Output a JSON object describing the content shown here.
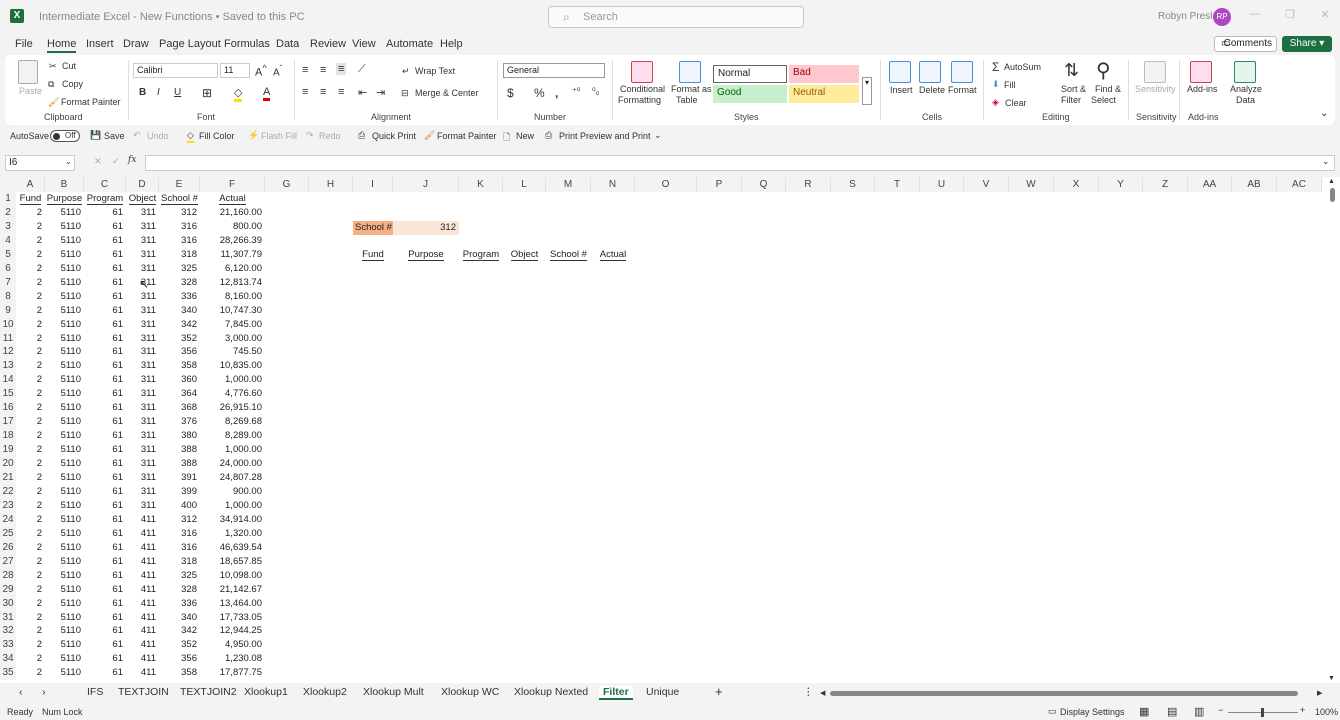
{
  "window": {
    "title": "Intermediate Excel - New Functions • Saved to this PC",
    "search_placeholder": "Search",
    "user": "Robyn Presley",
    "user_initials": "RP"
  },
  "menu": [
    "File",
    "Home",
    "Insert",
    "Draw",
    "Page Layout",
    "Formulas",
    "Data",
    "Review",
    "View",
    "Automate",
    "Help"
  ],
  "menu_active": "Home",
  "buttons": {
    "comments": "Comments",
    "share": "Share"
  },
  "ribbon": {
    "clipboard": {
      "paste": "Paste",
      "cut": "Cut",
      "copy": "Copy",
      "format_painter": "Format Painter",
      "label": "Clipboard"
    },
    "font": {
      "name": "Calibri",
      "size": "11",
      "label": "Font"
    },
    "alignment": {
      "wrap": "Wrap Text",
      "merge": "Merge & Center",
      "label": "Alignment"
    },
    "number": {
      "format": "General",
      "label": "Number"
    },
    "styles": {
      "cond": "Conditional",
      "cond2": "Formatting",
      "table": "Format as",
      "table2": "Table",
      "normal": "Normal",
      "bad": "Bad",
      "good": "Good",
      "neutral": "Neutral",
      "label": "Styles"
    },
    "cells": {
      "insert": "Insert",
      "delete": "Delete",
      "format": "Format",
      "label": "Cells"
    },
    "editing": {
      "autosum": "AutoSum",
      "fill": "Fill",
      "clear": "Clear",
      "sort": "Sort &",
      "sort2": "Filter",
      "find": "Find &",
      "find2": "Select",
      "label": "Editing"
    },
    "sensitivity": {
      "btn": "Sensitivity",
      "label": "Sensitivity"
    },
    "addins": {
      "btn": "Add-ins",
      "label": "Add-ins"
    },
    "analyze": {
      "btn": "Analyze",
      "btn2": "Data"
    }
  },
  "qat": {
    "autosave": "AutoSave",
    "off": "Off",
    "save": "Save",
    "undo": "Undo",
    "fill_color": "Fill Color",
    "flash_fill": "Flash Fill",
    "redo": "Redo",
    "quick_print": "Quick Print",
    "format_painter": "Format Painter",
    "new": "New",
    "print_preview": "Print Preview and Print"
  },
  "name_box": "I6",
  "columns": [
    "A",
    "B",
    "C",
    "D",
    "E",
    "F",
    "G",
    "H",
    "I",
    "J",
    "K",
    "L",
    "M",
    "N",
    "O",
    "P",
    "Q",
    "R",
    "S",
    "T",
    "U",
    "V",
    "W",
    "X",
    "Y",
    "Z",
    "AA",
    "AB",
    "AC"
  ],
  "headers": [
    "Fund",
    "Purpose",
    "Program",
    "Object",
    "School #",
    "Actual"
  ],
  "rows": [
    [
      "2",
      "5110",
      "61",
      "311",
      "312",
      "21,160.00"
    ],
    [
      "2",
      "5110",
      "61",
      "311",
      "316",
      "800.00"
    ],
    [
      "2",
      "5110",
      "61",
      "311",
      "316",
      "28,266.39"
    ],
    [
      "2",
      "5110",
      "61",
      "311",
      "318",
      "11,307.79"
    ],
    [
      "2",
      "5110",
      "61",
      "311",
      "325",
      "6,120.00"
    ],
    [
      "2",
      "5110",
      "61",
      "311",
      "328",
      "12,813.74"
    ],
    [
      "2",
      "5110",
      "61",
      "311",
      "336",
      "8,160.00"
    ],
    [
      "2",
      "5110",
      "61",
      "311",
      "340",
      "10,747.30"
    ],
    [
      "2",
      "5110",
      "61",
      "311",
      "342",
      "7,845.00"
    ],
    [
      "2",
      "5110",
      "61",
      "311",
      "352",
      "3,000.00"
    ],
    [
      "2",
      "5110",
      "61",
      "311",
      "356",
      "745.50"
    ],
    [
      "2",
      "5110",
      "61",
      "311",
      "358",
      "10,835.00"
    ],
    [
      "2",
      "5110",
      "61",
      "311",
      "360",
      "1,000.00"
    ],
    [
      "2",
      "5110",
      "61",
      "311",
      "364",
      "4,776.60"
    ],
    [
      "2",
      "5110",
      "61",
      "311",
      "368",
      "26,915.10"
    ],
    [
      "2",
      "5110",
      "61",
      "311",
      "376",
      "8,269.68"
    ],
    [
      "2",
      "5110",
      "61",
      "311",
      "380",
      "8,289.00"
    ],
    [
      "2",
      "5110",
      "61",
      "311",
      "388",
      "1,000.00"
    ],
    [
      "2",
      "5110",
      "61",
      "311",
      "388",
      "24,000.00"
    ],
    [
      "2",
      "5110",
      "61",
      "311",
      "391",
      "24,807.28"
    ],
    [
      "2",
      "5110",
      "61",
      "311",
      "399",
      "900.00"
    ],
    [
      "2",
      "5110",
      "61",
      "311",
      "400",
      "1,000.00"
    ],
    [
      "2",
      "5110",
      "61",
      "411",
      "312",
      "34,914.00"
    ],
    [
      "2",
      "5110",
      "61",
      "411",
      "316",
      "1,320.00"
    ],
    [
      "2",
      "5110",
      "61",
      "411",
      "316",
      "46,639.54"
    ],
    [
      "2",
      "5110",
      "61",
      "411",
      "318",
      "18,657.85"
    ],
    [
      "2",
      "5110",
      "61",
      "411",
      "325",
      "10,098.00"
    ],
    [
      "2",
      "5110",
      "61",
      "411",
      "328",
      "21,142.67"
    ],
    [
      "2",
      "5110",
      "61",
      "411",
      "336",
      "13,464.00"
    ],
    [
      "2",
      "5110",
      "61",
      "411",
      "340",
      "17,733.05"
    ],
    [
      "2",
      "5110",
      "61",
      "411",
      "342",
      "12,944.25"
    ],
    [
      "2",
      "5110",
      "61",
      "411",
      "352",
      "4,950.00"
    ],
    [
      "2",
      "5110",
      "61",
      "411",
      "356",
      "1,230.08"
    ],
    [
      "2",
      "5110",
      "61",
      "411",
      "358",
      "17,877.75"
    ]
  ],
  "filter_area": {
    "school_label": "School #",
    "school_value": "312",
    "headers": [
      "Fund",
      "Purpose",
      "Program",
      "Object",
      "School #",
      "Actual"
    ]
  },
  "sheets": [
    "IFS",
    "TEXTJOIN",
    "TEXTJOIN2",
    "Xlookup1",
    "Xlookup2",
    "Xlookup Mult",
    "Xlookup WC",
    "Xlookup Nexted",
    "Filter",
    "Unique"
  ],
  "active_sheet": "Filter",
  "status": {
    "ready": "Ready",
    "numlock": "Num Lock",
    "display": "Display Settings",
    "zoom": "100%"
  },
  "colors": {
    "excel_green": "#1d6f42",
    "school_label_bg": "#f4b183",
    "school_value_bg": "#fbe5d6"
  }
}
